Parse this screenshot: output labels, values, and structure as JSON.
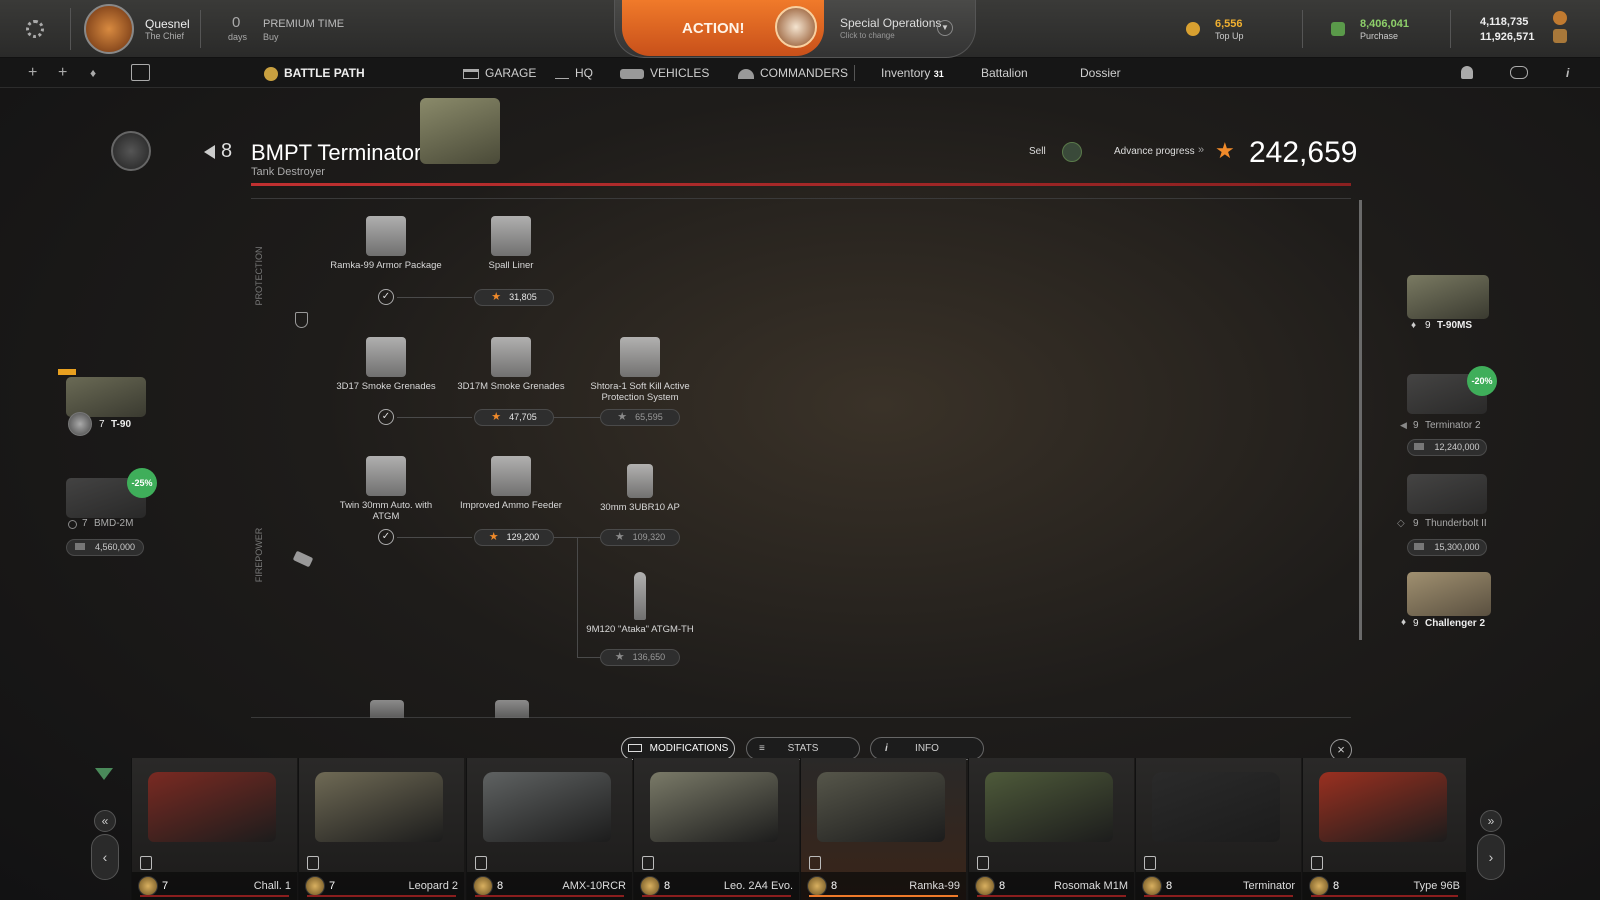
{
  "topbar": {
    "player_name": "Quesnel",
    "player_title": "The Chief",
    "premium_days": "0",
    "premium_days_label": "days",
    "premium_label": "PREMIUM TIME",
    "premium_buy": "Buy",
    "action_label": "ACTION!",
    "special_ops": "Special Operations",
    "special_ops_sub": "Click to change",
    "gold_value": "6,556",
    "gold_action": "Top Up",
    "credits_value": "8,406,041",
    "credits_action": "Purchase",
    "xp_top": "4,118,735",
    "xp_bottom": "11,926,571"
  },
  "nav": {
    "battle_path": "BATTLE PATH",
    "garage": "GARAGE",
    "hq": "HQ",
    "vehicles": "VEHICLES",
    "commanders": "COMMANDERS",
    "inventory": "Inventory",
    "inventory_count": "31",
    "battalion": "Battalion",
    "dossier": "Dossier"
  },
  "vehicle": {
    "tier": "8",
    "name": "BMPT Terminator",
    "class": "Tank Destroyer",
    "sell": "Sell",
    "advance": "Advance progress",
    "xp": "242,659"
  },
  "sections": {
    "protection": "PROTECTION",
    "firepower": "FIREPOWER"
  },
  "mods": [
    {
      "name": "Ramka-99 Armor Package",
      "status": "owned"
    },
    {
      "name": "Spall Liner",
      "cost": "31,805"
    },
    {
      "name": "3D17 Smoke Grenades",
      "status": "owned"
    },
    {
      "name": "3D17M Smoke Grenades",
      "cost": "47,705"
    },
    {
      "name": "Shtora-1 Soft Kill Active Protection System",
      "cost": "65,595"
    },
    {
      "name": "Twin 30mm Auto. with ATGM",
      "status": "owned"
    },
    {
      "name": "Improved Ammo Feeder",
      "cost": "129,200"
    },
    {
      "name": "30mm 3UBR10 AP",
      "cost": "109,320"
    },
    {
      "name": "9M120 \"Ataka\" ATGM-TH",
      "cost": "136,650"
    }
  ],
  "left_tree": [
    {
      "tier": "7",
      "name": "T-90"
    },
    {
      "tier": "7",
      "name": "BMD-2M",
      "discount": "-25%",
      "price": "4,560,000"
    }
  ],
  "right_tree": [
    {
      "tier": "9",
      "name": "T-90MS"
    },
    {
      "tier": "9",
      "name": "Terminator 2",
      "discount": "-20%",
      "price": "12,240,000"
    },
    {
      "tier": "9",
      "name": "Thunderbolt II",
      "price": "15,300,000"
    },
    {
      "tier": "9",
      "name": "Challenger 2"
    }
  ],
  "tabs": {
    "modifications": "MODIFICATIONS",
    "stats": "STATS",
    "info": "INFO"
  },
  "carousel": [
    {
      "tier": "7",
      "name": "Chall. 1",
      "color": "#7a2a22"
    },
    {
      "tier": "7",
      "name": "Leopard 2",
      "color": "#6f6a55"
    },
    {
      "tier": "8",
      "name": "AMX-10RCR",
      "color": "#5f6262"
    },
    {
      "tier": "8",
      "name": "Leo. 2A4 Evo.",
      "color": "#7a7a68"
    },
    {
      "tier": "8",
      "name": "Ramka-99",
      "color": "#56564a"
    },
    {
      "tier": "8",
      "name": "Rosomak M1M",
      "color": "#4e5a3a"
    },
    {
      "tier": "8",
      "name": "Terminator",
      "color": "#2a2a2a"
    },
    {
      "tier": "8",
      "name": "Type 96B",
      "color": "#9a3020"
    }
  ],
  "colors": {
    "accent": "#f07a2a",
    "gold": "#f0b030",
    "credits": "#8ed06a",
    "discount": "#3fae5a"
  }
}
